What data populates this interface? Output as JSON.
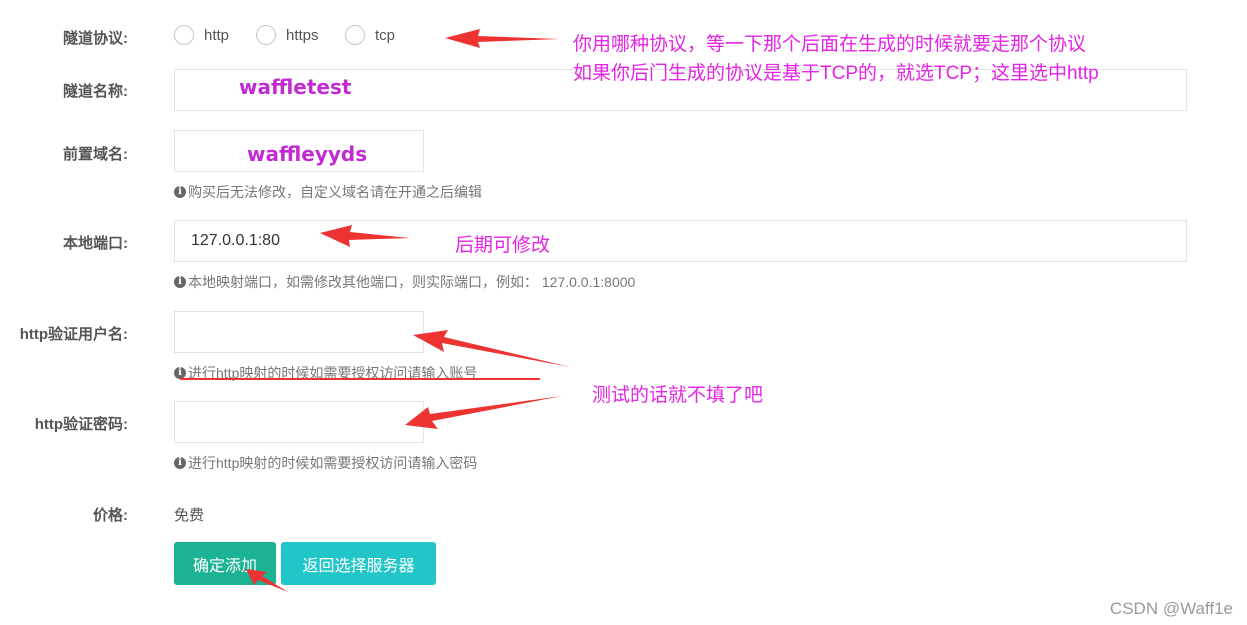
{
  "form": {
    "protocol": {
      "label": "隧道协议:",
      "options": [
        "http",
        "https",
        "tcp"
      ]
    },
    "tunnel_name": {
      "label": "隧道名称:",
      "value": ""
    },
    "prefix_domain": {
      "label": "前置域名:",
      "value": "",
      "hint": "购买后无法修改，自定义域名请在开通之后编辑"
    },
    "local_port": {
      "label": "本地端口:",
      "value": "127.0.0.1:80",
      "hint": "本地映射端口，如需修改其他端口，则实际端口，例如： 127.0.0.1:8000"
    },
    "http_user": {
      "label": "http验证用户名:",
      "value": "",
      "hint": "进行http映射的时候如需要授权访问请输入账号"
    },
    "http_password": {
      "label": "http验证密码:",
      "value": "",
      "hint": "进行http映射的时候如需要授权访问请输入密码"
    },
    "price": {
      "label": "价格:",
      "value": "免费"
    },
    "buttons": {
      "confirm": "确定添加",
      "back": "返回选择服务器"
    }
  },
  "annotations": {
    "protocol_note_line1": "你用哪种协议，等一下那个后面在生成的时候就要走那个协议",
    "protocol_note_line2": "如果你后门生成的协议是基于TCP的，就选TCP；这里选中http",
    "tunnel_name_overlay": "waffletest",
    "domain_overlay": "waffleyyds",
    "port_note": "后期可修改",
    "auth_note": "测试的话就不填了吧"
  },
  "watermark": "CSDN @Waff1e",
  "colors": {
    "confirm_button": "#1bb394",
    "back_button": "#23c6c8",
    "annotation_text": "#e624e6",
    "arrow": "#ee3333",
    "info_icon": "#666666"
  },
  "icons": {
    "hint_icon": "info-circle-icon"
  }
}
